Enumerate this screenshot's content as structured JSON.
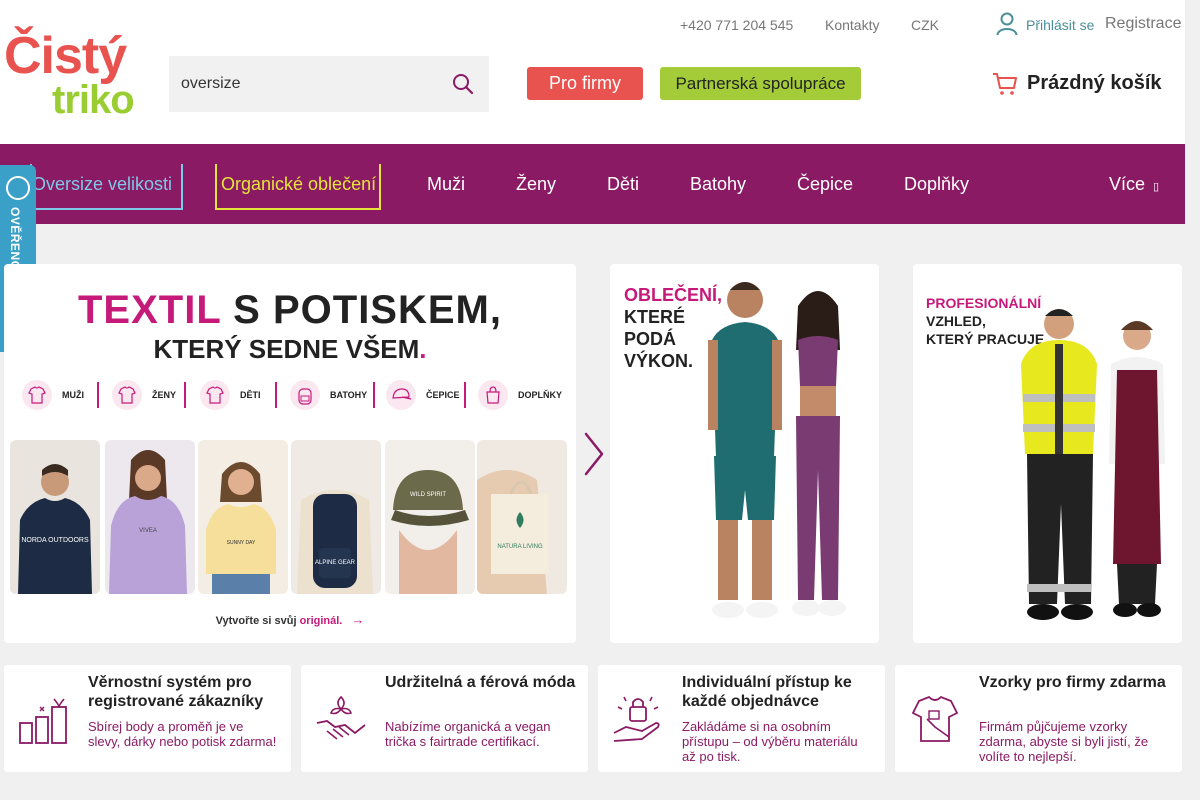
{
  "header": {
    "logo": {
      "line1": "Čistý",
      "line2": "triko"
    },
    "search": {
      "value": "oversize",
      "placeholder": ""
    },
    "buttons": {
      "for_companies": "Pro firmy",
      "partnership": "Partnerská spolupráce"
    },
    "toplinks": {
      "phone": "+420 771 204 545",
      "contacts": "Kontakty",
      "currency": "CZK",
      "login": "Přihlásit se",
      "register": "Registrace"
    },
    "cart": {
      "label": "Prázdný košík"
    }
  },
  "nav": {
    "items": [
      "Oversize velikosti",
      "Organické oblečení",
      "Muži",
      "Ženy",
      "Děti",
      "Batohy",
      "Čepice",
      "Doplňky"
    ],
    "more": "Více"
  },
  "badge": {
    "text": "OVĚŘENO ZÁKAZNÍKY"
  },
  "banners": {
    "main": {
      "title_pink": "TEXTIL",
      "title_rest": " S POTISKEM,",
      "subtitle": "KTERÝ SEDNE VŠEM",
      "subtitle_dot": ".",
      "categories": [
        "MUŽI",
        "ŽENY",
        "DĚTI",
        "BATOHY",
        "ČEPICE",
        "DOPLŇKY"
      ],
      "tiles": [
        "NORDA OUTDOORS",
        "VIVEA",
        "SUNNY DAY",
        "ALPINE GEAR",
        "WILD SPIRIT",
        "NATURA LIVING"
      ],
      "cta_text": "Vytvořte si svůj ",
      "cta_pink": "originál."
    },
    "sport": {
      "line1": "OBLEČENÍ,",
      "line2": "KTERÉ",
      "line3": "PODÁ",
      "line4": "VÝKON."
    },
    "work": {
      "line1": "PROFESIONÁLNÍ",
      "line2": "VZHLED,",
      "line3": "KTERÝ PRACUJE."
    }
  },
  "features": [
    {
      "title": "Věrnostní systém pro registrované zákazníky",
      "text": "Sbírej body a proměň je ve slevy, dárky nebo potisk zdarma!"
    },
    {
      "title": "Udržitelná a férová móda",
      "text": "Nabízíme organická a vegan trička s fairtrade certifikací."
    },
    {
      "title": "Individuální přístup ke každé objednávce",
      "text": "Zakládáme si na osobním přístupu – od výběru materiálu až po tisk."
    },
    {
      "title": "Vzorky pro firmy zdarma",
      "text": "Firmám půjčujeme vzorky zdarma, abyste si byli jistí, že volíte to nejlepší."
    }
  ],
  "colors": {
    "brand_red": "#e8524f",
    "brand_green": "#9acd32",
    "nav_purple": "#8b1a64",
    "accent_pink": "#c61a7b",
    "badge_blue": "#3aa0c8"
  }
}
